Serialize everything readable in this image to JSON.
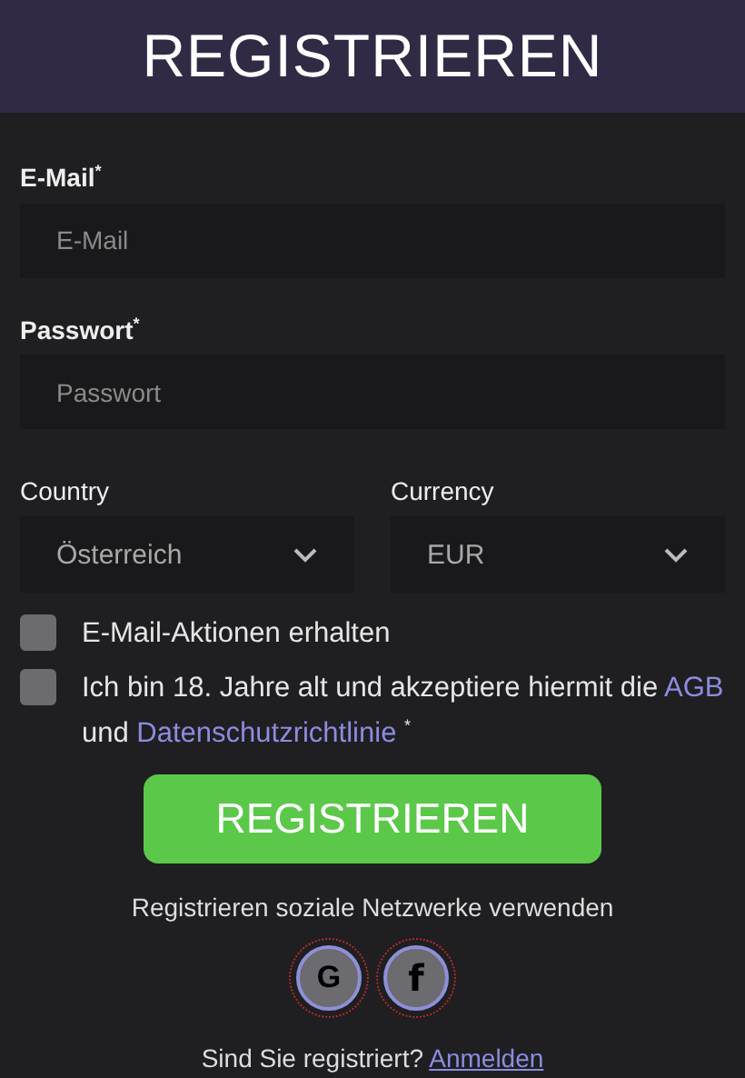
{
  "header": {
    "title": "REGISTRIEREN"
  },
  "fields": [
    {
      "label": "E-Mail$^{*}$",
      "placeholder": "E-Mail"
    },
    {
      "label": "Passwort$^{*}$",
      "placeholder": "Passwort"
    }
  ],
  "selects": [
    {
      "label": "Country",
      "value": "Österreich"
    },
    {
      "label": "Currency",
      "value": "EUR"
    }
  ],
  "checkboxes": [
    {
      "checked": false,
      "parts": [
        {
          "kind": "text",
          "text": "E-Mail-Aktionen erhalten"
        }
      ]
    },
    {
      "checked": false,
      "parts": [
        {
          "kind": "text",
          "text": "Ich bin 18. Jahre alt und akzeptiere hiermit die "
        },
        {
          "kind": "link",
          "text": "AGB"
        },
        {
          "kind": "text",
          "text": " und "
        },
        {
          "kind": "link",
          "text": "Datenschutzrichtlinie"
        },
        {
          "kind": "text",
          "text": " $^{*}$"
        }
      ]
    }
  ],
  "submit": "REGISTRIEREN",
  "social": {
    "caption": "Registrieren soziale Netzwerke verwenden",
    "buttons": [
      {
        "kind": "google",
        "glyph": "G"
      },
      {
        "kind": "facebook",
        "glyph": "f"
      }
    ]
  },
  "footer": {
    "text": "Sind Sie registriert?",
    "link": "Anmelden"
  }
}
